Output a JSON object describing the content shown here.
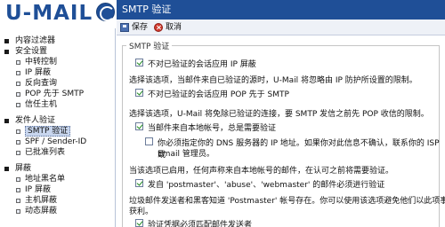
{
  "logo": {
    "text": "U-MAIL"
  },
  "sidebar": {
    "items": [
      {
        "label": "内容过滤器",
        "level": 0,
        "bullet": "dot"
      },
      {
        "label": "安全设置",
        "level": 0,
        "bullet": "dot"
      },
      {
        "label": "中转控制",
        "level": 1,
        "bullet": "square"
      },
      {
        "label": "IP 屏蔽",
        "level": 1,
        "bullet": "square"
      },
      {
        "label": "反向查询",
        "level": 1,
        "bullet": "square"
      },
      {
        "label": "POP 先于 SMTP",
        "level": 1,
        "bullet": "square"
      },
      {
        "label": "信任主机",
        "level": 1,
        "bullet": "square"
      },
      {
        "label": "发件人验证",
        "level": 0,
        "bullet": "dot",
        "gap_before": true
      },
      {
        "label": "SMTP 验证",
        "level": 1,
        "bullet": "square",
        "selected": true
      },
      {
        "label": "SPF / Sender-ID",
        "level": 1,
        "bullet": "square"
      },
      {
        "label": "已批准列表",
        "level": 1,
        "bullet": "square"
      },
      {
        "label": "屏蔽",
        "level": 0,
        "bullet": "dot",
        "gap_before": true
      },
      {
        "label": "地址黑名单",
        "level": 1,
        "bullet": "square"
      },
      {
        "label": "IP 屏蔽",
        "level": 1,
        "bullet": "square"
      },
      {
        "label": "主机屏蔽",
        "level": 1,
        "bullet": "square"
      },
      {
        "label": "动态屏蔽",
        "level": 1,
        "bullet": "square"
      }
    ]
  },
  "header": {
    "title": "SMTP 验证"
  },
  "toolbar": {
    "save_label": "保存",
    "cancel_label": "取消"
  },
  "section": {
    "legend": "SMTP 验证",
    "opt1": {
      "label": "不对已验证的会话应用 IP 屏蔽",
      "checked": true
    },
    "desc1": "选择该选项，当邮件来自已验证的源时，U-Mail 将忽略由 IP 防护所设置的限制。",
    "opt2": {
      "label": "不对已验证的会话应用 POP 先于 SMTP",
      "checked": true
    },
    "desc2": "选择该选项，U-Mail 将免除已验证的连接，要 SMTP 发信之前先 POP 收信的限制。",
    "opt3": {
      "label": "当邮件来自本地帐号，总是需要验证",
      "checked": true
    },
    "opt3a": {
      "label": "你必须指定你的 DNS 服务器的 IP 地址。如果你对此信息不确认，联系你的 ISP 或",
      "checked": false
    },
    "opt3a_cont": "Email 管理员。",
    "desc3": "当该选项已启用，任何声称来自本地帐号的邮件，在认可之前将需要验证。",
    "opt4": {
      "label": "发自 'postmaster'、'abuse'、'webmaster' 的邮件必须进行验证",
      "checked": true
    },
    "desc4a": "垃圾邮件发送者和黑客知道 'Postmaster' 帐号存在。你可以使用该选项避免他们以此项事实",
    "desc4b": "获利。",
    "opt5": {
      "label": "验证凭据必须匹配邮件发送者",
      "checked": true
    }
  }
}
